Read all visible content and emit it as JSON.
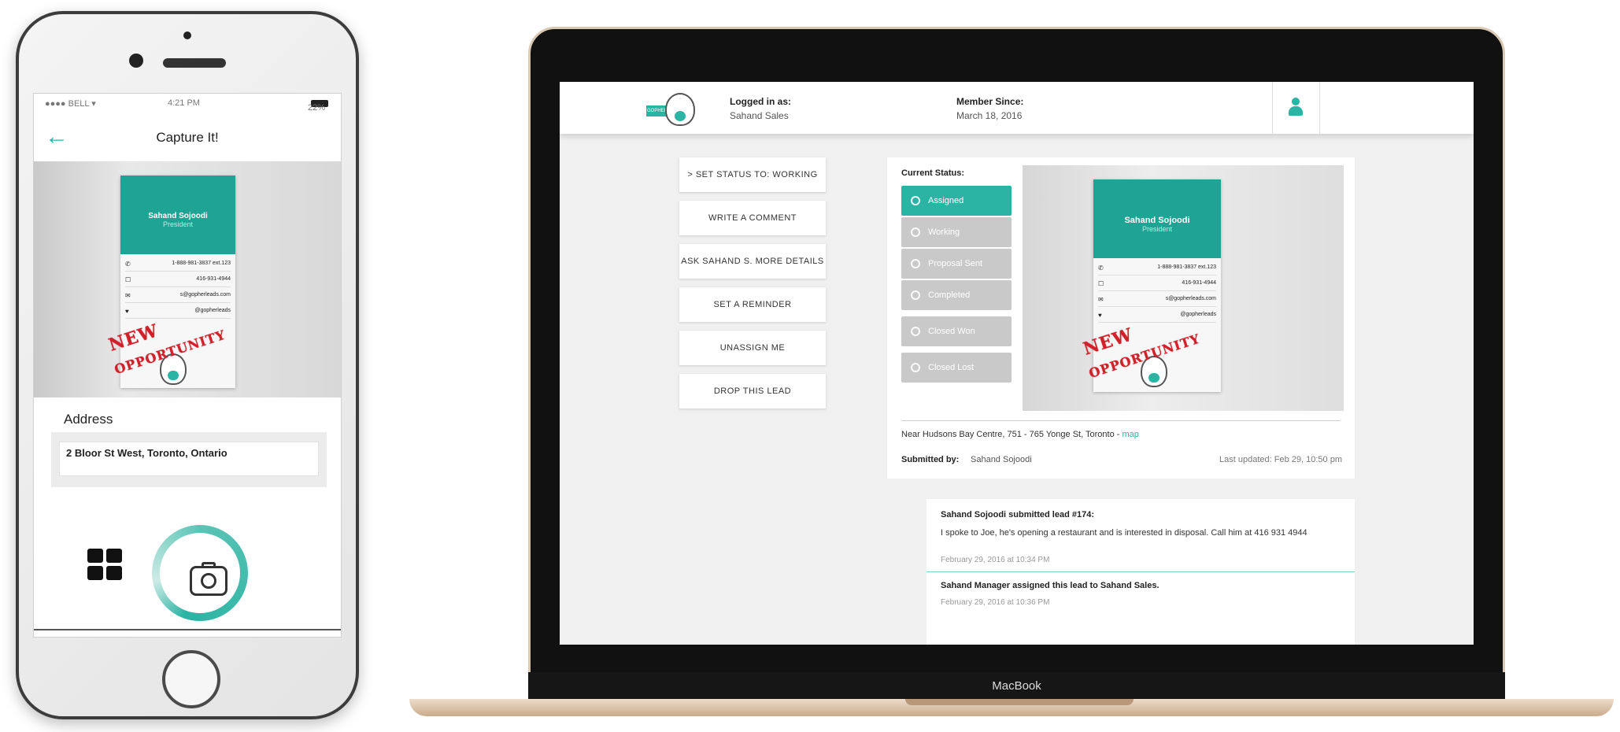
{
  "phone": {
    "status": {
      "carrier": "●●●● BELL ▾",
      "time": "4:21 PM",
      "battery": "22%"
    },
    "title": "Capture It!",
    "card": {
      "name": "Sahand Sojoodi",
      "role": "President",
      "rows": [
        {
          "icon": "✆",
          "text": "1-888-981-3837 ext.123"
        },
        {
          "icon": "☐",
          "text": "416-931-4944"
        },
        {
          "icon": "✉",
          "text": "s@gopherleads.com"
        },
        {
          "icon": "♥",
          "text": "@gopherleads"
        }
      ],
      "stamp_line1": "NEW",
      "stamp_line2": "OPPORTUNITY"
    },
    "address_label": "Address",
    "address_value": "2 Bloor St West, Toronto, Ontario"
  },
  "laptop": {
    "brand": "MacBook",
    "header": {
      "logo_tag": "GOPHER",
      "logged_in_label": "Logged in as:",
      "logged_in_value": "Sahand Sales",
      "member_since_label": "Member Since:",
      "member_since_value": "March 18, 2016"
    },
    "actions": [
      "> SET STATUS TO: WORKING",
      "WRITE A COMMENT",
      "ASK SAHAND S. MORE DETAILS",
      "SET A REMINDER",
      "UNASSIGN ME",
      "DROP THIS LEAD"
    ],
    "status": {
      "label": "Current Status:",
      "options": [
        {
          "label": "Assigned",
          "active": true
        },
        {
          "label": "Working",
          "active": false
        },
        {
          "label": "Proposal Sent",
          "active": false
        },
        {
          "label": "Completed",
          "active": false
        },
        {
          "label": "Closed Won",
          "active": false
        },
        {
          "label": "Closed Lost",
          "active": false
        }
      ]
    },
    "card": {
      "name": "Sahand Sojoodi",
      "role": "President",
      "rows": [
        {
          "icon": "✆",
          "text": "1-888-981-3837 ext.123"
        },
        {
          "icon": "☐",
          "text": "416-931-4944"
        },
        {
          "icon": "✉",
          "text": "s@gopherleads.com"
        },
        {
          "icon": "♥",
          "text": "@gopherleads"
        }
      ],
      "stamp_line1": "NEW",
      "stamp_line2": "OPPORTUNITY"
    },
    "location": "Near Hudsons Bay Centre, 751 - 765 Yonge St, Toronto - ",
    "map_link": "map",
    "submitted_label": "Submitted by:",
    "submitted_value": "Sahand Sojoodi",
    "last_updated": "Last updated: Feb 29, 10:50 pm",
    "comments": [
      {
        "title": "Sahand Sojoodi submitted lead #174:",
        "body": "I spoke to Joe, he's opening a restaurant and is interested in disposal. Call him at 416 931 4944",
        "date": "February 29, 2016 at 10:34 PM"
      },
      {
        "title": "Sahand Manager assigned this lead to Sahand Sales.",
        "body": "",
        "date": "February 29, 2016 at 10:36 PM"
      }
    ]
  },
  "colors": {
    "accent": "#2bb3a3",
    "inactive_status": "#c9c9c9",
    "stamp": "#d0202a"
  }
}
